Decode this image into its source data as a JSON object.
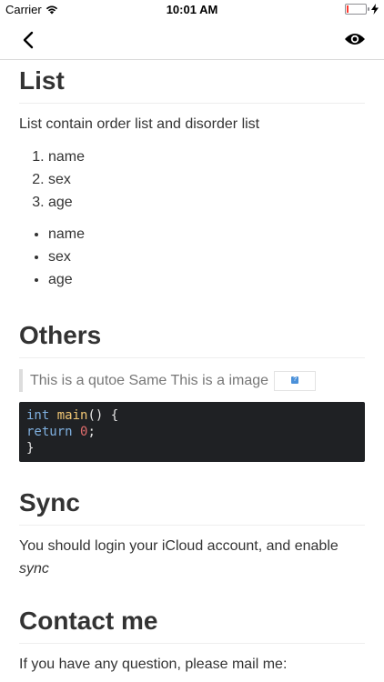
{
  "status_bar": {
    "carrier": "Carrier",
    "time": "10:01 AM"
  },
  "sections": {
    "list": {
      "title": "List",
      "intro": "List contain order list and disorder list",
      "ordered": [
        "name",
        "sex",
        "age"
      ],
      "unordered": [
        "name",
        "sex",
        "age"
      ]
    },
    "others": {
      "title": "Others",
      "quote": "This is a qutoe Same This is a image",
      "code": {
        "line1_kw": "int",
        "line1_fn": "main",
        "line1_rest": "() {",
        "line2_kw": "return",
        "line2_num": "0",
        "line2_rest": ";",
        "line3": "}"
      }
    },
    "sync": {
      "title": "Sync",
      "text": "You should login your iCloud account, and enable",
      "emphasis": "sync"
    },
    "contact": {
      "title": "Contact me",
      "text": "If you have any question, please mail me:"
    }
  },
  "icons": {
    "back": "chevron-left-icon",
    "preview": "eye-icon",
    "wifi": "wifi-icon",
    "battery": "battery-icon",
    "charging": "bolt-icon"
  },
  "colors": {
    "battery_low": "#ff3b30",
    "code_bg": "#1f2124"
  }
}
